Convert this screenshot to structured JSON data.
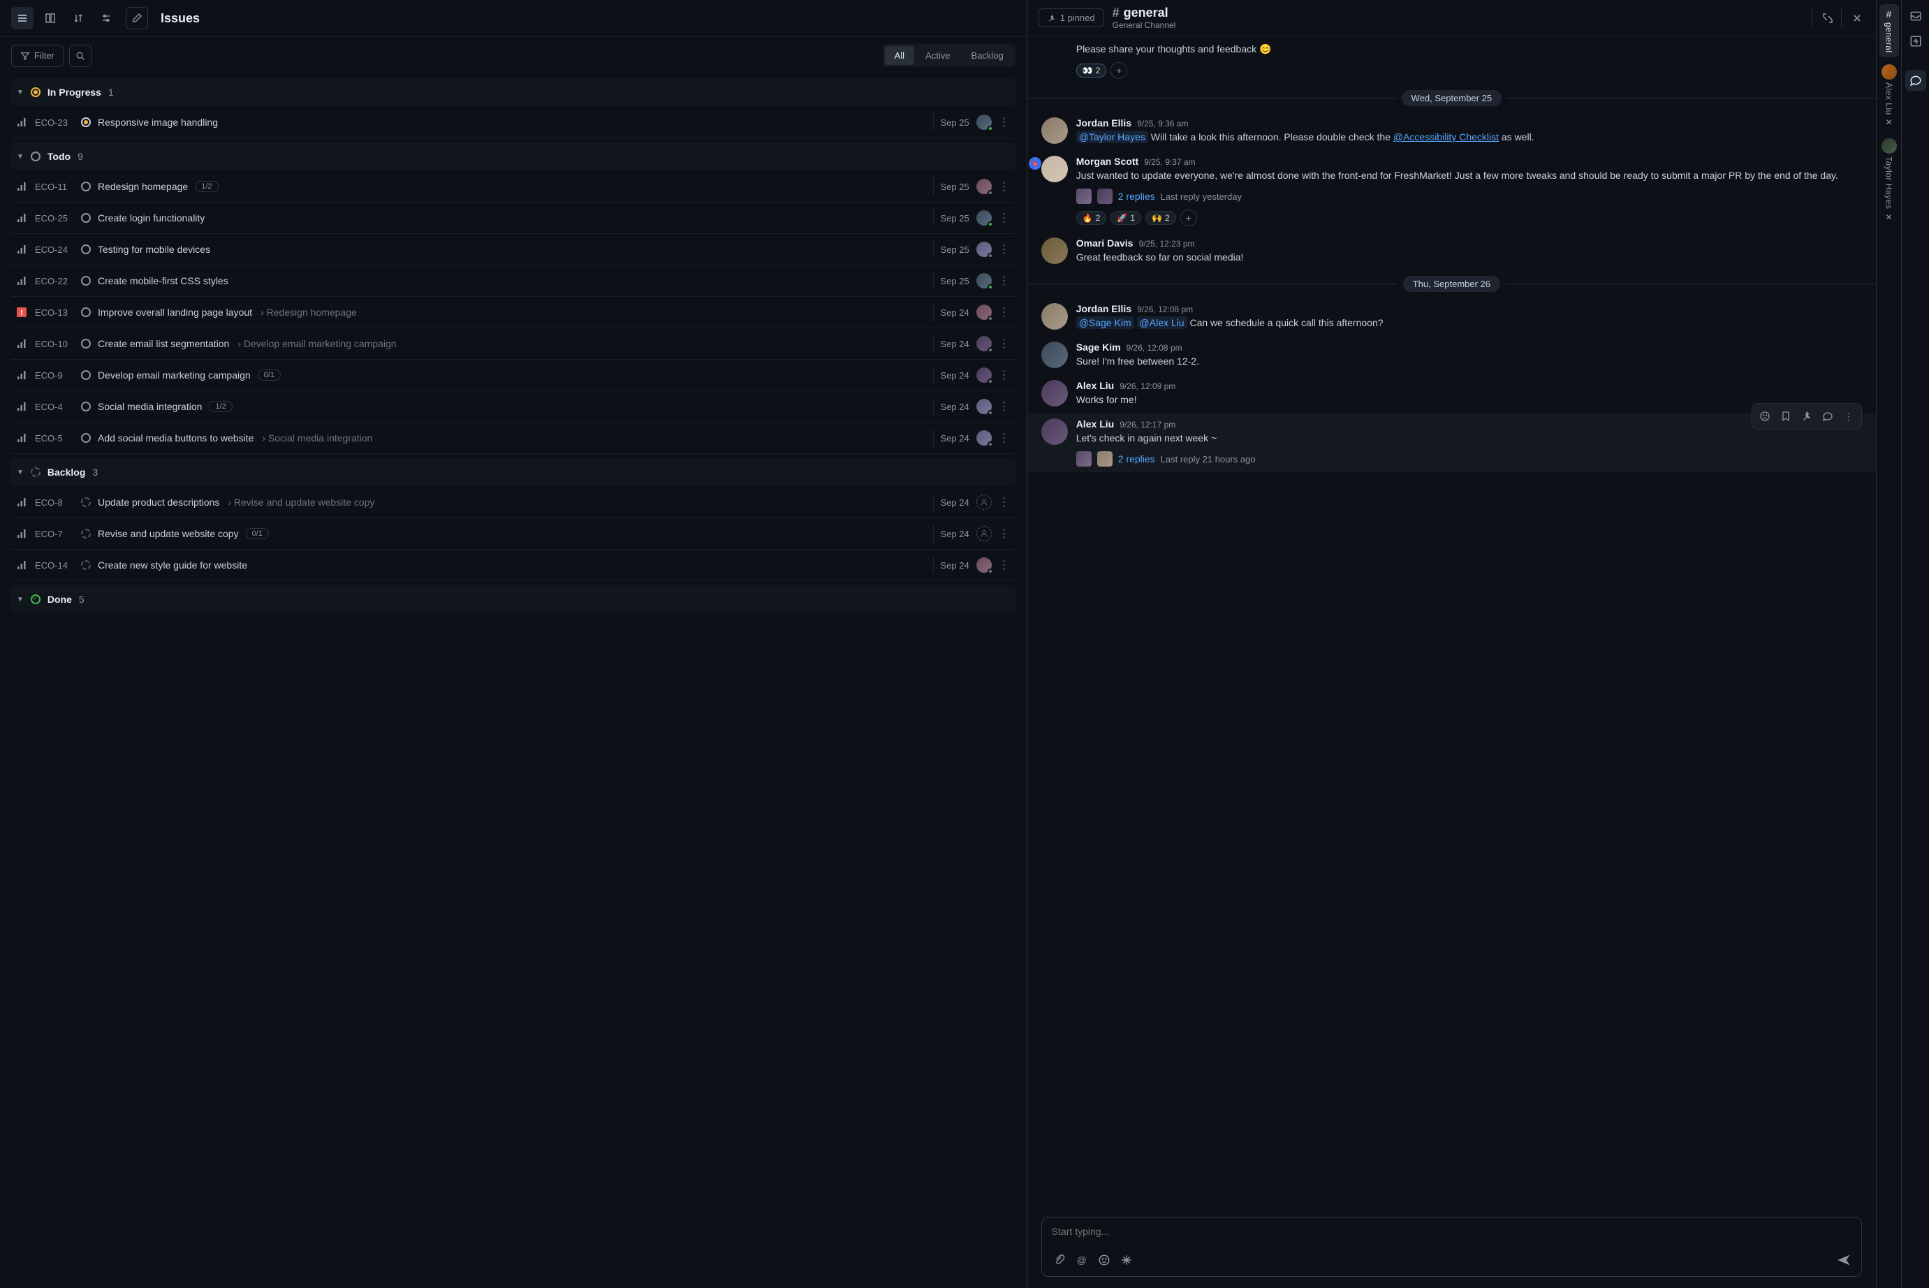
{
  "header": {
    "title": "Issues",
    "filter_label": "Filter",
    "tabs": {
      "all": "All",
      "active": "Active",
      "backlog": "Backlog"
    }
  },
  "groups": {
    "in_progress": {
      "name": "In Progress",
      "count": "1"
    },
    "todo": {
      "name": "Todo",
      "count": "9"
    },
    "backlog": {
      "name": "Backlog",
      "count": "3"
    },
    "done": {
      "name": "Done",
      "count": "5"
    }
  },
  "issues": {
    "i23": {
      "key": "ECO-23",
      "title": "Responsive image handling",
      "date": "Sep 25"
    },
    "i11": {
      "key": "ECO-11",
      "title": "Redesign homepage",
      "counter": "1/2",
      "date": "Sep 25"
    },
    "i25": {
      "key": "ECO-25",
      "title": "Create login functionality",
      "date": "Sep 25"
    },
    "i24": {
      "key": "ECO-24",
      "title": "Testing for mobile devices",
      "date": "Sep 25"
    },
    "i22": {
      "key": "ECO-22",
      "title": "Create mobile-first CSS styles",
      "date": "Sep 25"
    },
    "i13": {
      "key": "ECO-13",
      "title": "Improve overall landing page layout",
      "parent": "› Redesign homepage",
      "date": "Sep 24"
    },
    "i10": {
      "key": "ECO-10",
      "title": "Create email list segmentation",
      "parent": "› Develop email marketing campaign",
      "date": "Sep 24"
    },
    "i9": {
      "key": "ECO-9",
      "title": "Develop email marketing campaign",
      "counter": "0/1",
      "date": "Sep 24"
    },
    "i4": {
      "key": "ECO-4",
      "title": "Social media integration",
      "counter": "1/2",
      "date": "Sep 24"
    },
    "i5": {
      "key": "ECO-5",
      "title": "Add social media buttons to website",
      "parent": "› Social media integration",
      "date": "Sep 24"
    },
    "i8": {
      "key": "ECO-8",
      "title": "Update product descriptions",
      "parent": "› Revise and update website copy",
      "date": "Sep 24"
    },
    "i7": {
      "key": "ECO-7",
      "title": "Revise and update website copy",
      "counter": "0/1",
      "date": "Sep 24"
    },
    "i14": {
      "key": "ECO-14",
      "title": "Create new style guide for website",
      "date": "Sep 24"
    }
  },
  "chat": {
    "pinned": "1 pinned",
    "channel_name": "general",
    "channel_sub": "General Channel",
    "top_partial": "Please share your thoughts and feedback 😊",
    "eyes_count": "2",
    "date1": "Wed, September 25",
    "date2": "Thu, September 26",
    "m_jordan1": {
      "author": "Jordan Ellis",
      "time": "9/25, 9:36 am",
      "mention": "@Taylor Hayes",
      "text1": " Will take a look this afternoon. Please double check the ",
      "link": "@Accessibility Checklist",
      "text2": " as well."
    },
    "m_morgan": {
      "author": "Morgan Scott",
      "time": "9/25, 9:37 am",
      "text": "Just wanted to update everyone, we're almost done with the front-end for FreshMarket! Just a few more tweaks and should be ready to submit a major PR by the end of the day.",
      "replies": "2 replies",
      "reply_time": "Last reply yesterday",
      "r_fire": "2",
      "r_rocket": "1",
      "r_hands": "2"
    },
    "m_omari": {
      "author": "Omari Davis",
      "time": "9/25, 12:23 pm",
      "text": "Great feedback so far on social media!"
    },
    "m_jordan2": {
      "author": "Jordan Ellis",
      "time": "9/26, 12:08 pm",
      "m1": "@Sage Kim",
      "m2": "@Alex Liu",
      "text": " Can we schedule a quick call this afternoon?"
    },
    "m_sage": {
      "author": "Sage Kim",
      "time": "9/26, 12:08 pm",
      "text": "Sure! I'm free between 12-2."
    },
    "m_alex1": {
      "author": "Alex Liu",
      "time": "9/26, 12:09 pm",
      "text": "Works for me!"
    },
    "m_alex2": {
      "author": "Alex Liu",
      "time": "9/26, 12:17 pm",
      "text": "Let's check in again next week ~",
      "replies": "2 replies",
      "reply_time": "Last reply 21 hours ago"
    },
    "composer_placeholder": "Start typing..."
  },
  "rail": {
    "general": "general",
    "alex": "Alex Liu",
    "taylor": "Taylor Hayes"
  }
}
